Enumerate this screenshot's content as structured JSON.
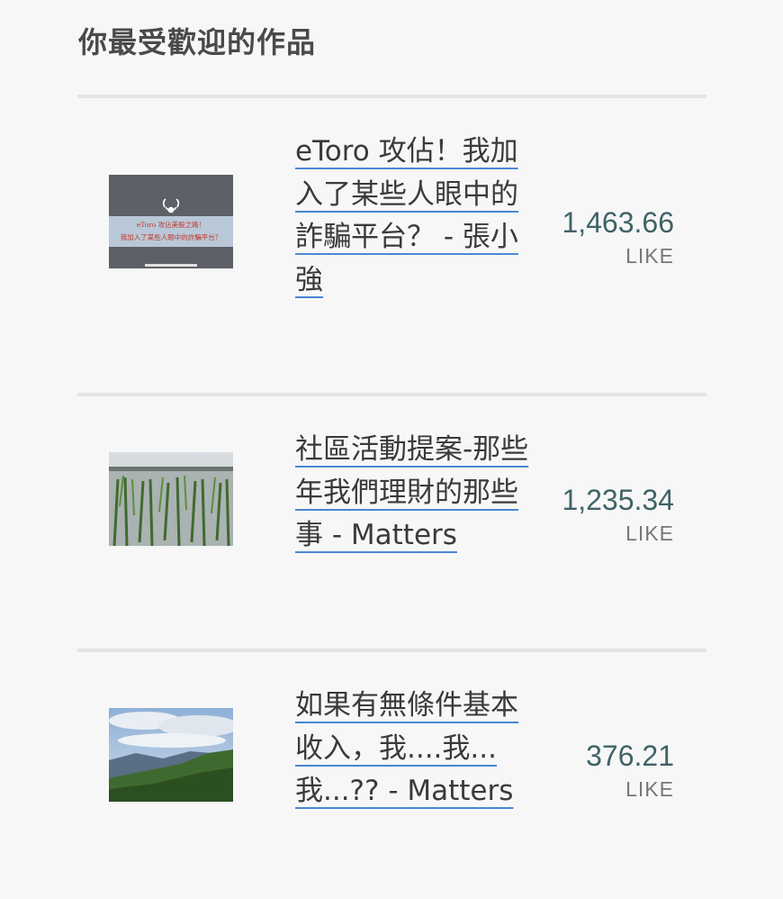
{
  "section": {
    "title": "你最受歡迎的作品"
  },
  "works": [
    {
      "title": "eToro 攻佔！我加入了某些人眼中的詐騙平台？ - 張小強",
      "amount": "1,463.66",
      "unit": "LIKE",
      "thumbnail": {
        "icon": "bull-logo",
        "caption_line1": "eToro 攻佔美股之路！",
        "caption_line2": "我加入了某些人眼中的詐騙平台？"
      }
    },
    {
      "title": "社區活動提案-那些年我們理財的那些事 - Matters",
      "amount": "1,235.34",
      "unit": "LIKE",
      "thumbnail": {
        "icon": "rice-paddy-image"
      }
    },
    {
      "title": "如果有無條件基本收入，我....我...我...?? - Matters",
      "amount": "376.21",
      "unit": "LIKE",
      "thumbnail": {
        "icon": "mountain-landscape-image"
      }
    }
  ]
}
